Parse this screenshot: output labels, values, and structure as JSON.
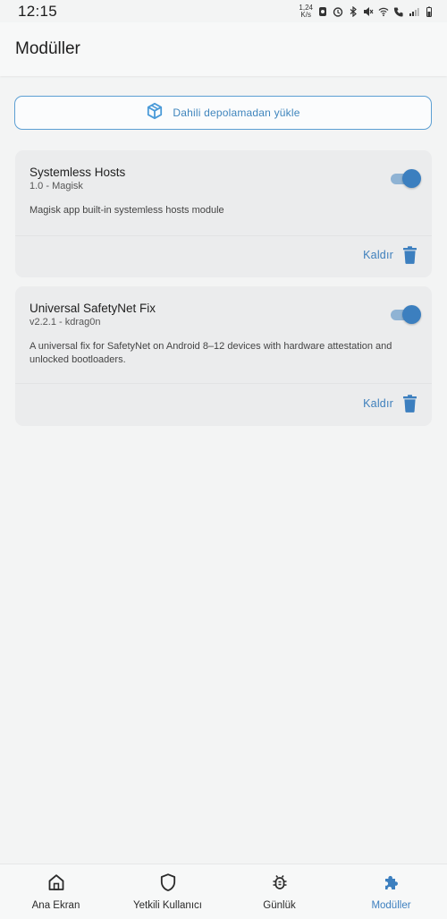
{
  "status_bar": {
    "time": "12:15",
    "net_speed_value": "1,24",
    "net_speed_unit": "K/s",
    "icons": [
      "dnd-icon",
      "alarm-icon",
      "bluetooth-icon",
      "mute-icon",
      "wifi-icon",
      "call-icon",
      "signal-icon",
      "battery-icon"
    ]
  },
  "app_bar": {
    "title": "Modüller"
  },
  "install": {
    "label": "Dahili depolamadan yükle",
    "icon": "package-icon"
  },
  "modules": [
    {
      "name": "Systemless Hosts",
      "version": "1.0 - Magisk",
      "description": "Magisk app built-in systemless hosts module",
      "enabled": true,
      "remove_label": "Kaldır"
    },
    {
      "name": "Universal SafetyNet Fix",
      "version": "v2.2.1 - kdrag0n",
      "description": "A universal fix for SafetyNet on Android 8–12 devices with hardware attestation and unlocked bootloaders.",
      "enabled": true,
      "remove_label": "Kaldır"
    }
  ],
  "bottom_nav": {
    "items": [
      {
        "label": "Ana Ekran",
        "icon": "home-icon"
      },
      {
        "label": "Yetkili Kullanıcı",
        "icon": "shield-icon"
      },
      {
        "label": "Günlük",
        "icon": "bug-icon"
      },
      {
        "label": "Modüller",
        "icon": "puzzle-icon",
        "active": true
      }
    ]
  },
  "colors": {
    "accent": "#3c7fbf",
    "background": "#f3f4f4",
    "card": "#ebeced"
  }
}
